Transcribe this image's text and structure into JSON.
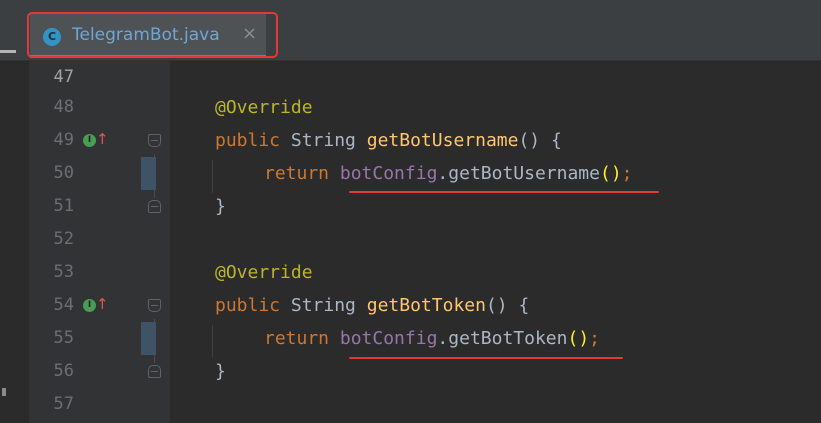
{
  "tab": {
    "icon_letter": "C",
    "icon_name": "java-class-icon",
    "label": "TelegramBot.java",
    "close_glyph": "×"
  },
  "colors": {
    "annotation": "#bbb529",
    "keyword": "#cc7832",
    "method_decl": "#ffc66d",
    "field": "#9876aa",
    "default_text": "#a9b7c6",
    "highlight_box": "#e0393a",
    "tab_accent": "#4a88c7"
  },
  "gutter_markers": {
    "implements_icon": "implements-method-icon",
    "implements_letter": "I",
    "arrow_glyph": "↑"
  },
  "lines": {
    "l47": {
      "num": "47"
    },
    "l48": {
      "num": "48",
      "anno": "@Override"
    },
    "l49": {
      "num": "49",
      "kw": "public",
      "type": "String",
      "fn": "getBotUsername",
      "rest": "() {"
    },
    "l50": {
      "num": "50",
      "kw": "return",
      "field": "botConfig",
      "dot": ".",
      "call": "getBotUsername",
      "paren": "()",
      "semi": ";"
    },
    "l51": {
      "num": "51",
      "brace": "}"
    },
    "l52": {
      "num": "52"
    },
    "l53": {
      "num": "53",
      "anno": "@Override"
    },
    "l54": {
      "num": "54",
      "kw": "public",
      "type": "String",
      "fn": "getBotToken",
      "rest": "() {"
    },
    "l55": {
      "num": "55",
      "kw": "return",
      "field": "botConfig",
      "dot": ".",
      "call": "getBotToken",
      "paren": "()",
      "semi": ";"
    },
    "l56": {
      "num": "56",
      "brace": "}"
    },
    "l57": {
      "num": "57"
    }
  }
}
